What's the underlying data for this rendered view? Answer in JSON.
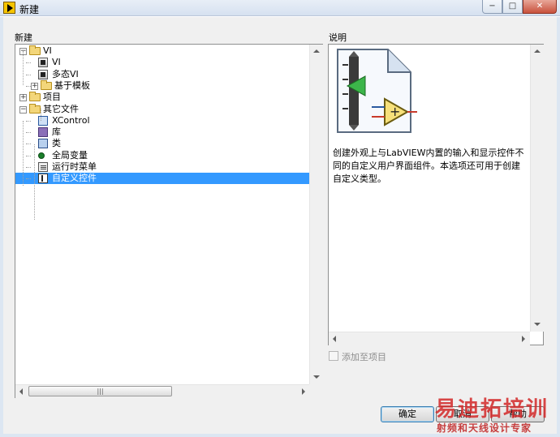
{
  "window": {
    "title": "新建"
  },
  "left_section": {
    "label": "新建"
  },
  "right_section": {
    "label": "说明"
  },
  "tree": [
    {
      "label": "VI",
      "icon": "folder-icon",
      "indent": 0,
      "expander": "−"
    },
    {
      "label": "VI",
      "icon": "vi-icon",
      "indent": 1
    },
    {
      "label": "多态VI",
      "icon": "polymorphic-vi-icon",
      "indent": 1
    },
    {
      "label": "基于模板",
      "icon": "folder-icon",
      "indent": 1,
      "expander": "+"
    },
    {
      "label": "项目",
      "icon": "folder-icon",
      "indent": 0,
      "expander": "+"
    },
    {
      "label": "其它文件",
      "icon": "folder-icon",
      "indent": 0,
      "expander": "−"
    },
    {
      "label": "XControl",
      "icon": "xcontrol-icon",
      "indent": 1
    },
    {
      "label": "库",
      "icon": "library-icon",
      "indent": 1
    },
    {
      "label": "类",
      "icon": "class-icon",
      "indent": 1
    },
    {
      "label": "全局变量",
      "icon": "global-variable-icon",
      "indent": 1
    },
    {
      "label": "运行时菜单",
      "icon": "runtime-menu-icon",
      "indent": 1
    },
    {
      "label": "自定义控件",
      "icon": "custom-control-icon",
      "indent": 1,
      "selected": true
    }
  ],
  "description": {
    "text": "创建外观上与LabVIEW内置的输入和显示控件不同的自定义用户界面组件。本选项还可用于创建自定义类型。",
    "icon": "custom-control-document-icon"
  },
  "add_to_project": {
    "label": "添加至项目",
    "checked": false,
    "enabled": false
  },
  "buttons": {
    "ok": "确定",
    "cancel": "取消",
    "help": "帮助"
  },
  "watermark": {
    "line1": "易迪拓培训",
    "line2": "射频和天线设计专家"
  },
  "colors": {
    "selection": "#3399ff",
    "dialog_bg": "#f0f0f0"
  }
}
